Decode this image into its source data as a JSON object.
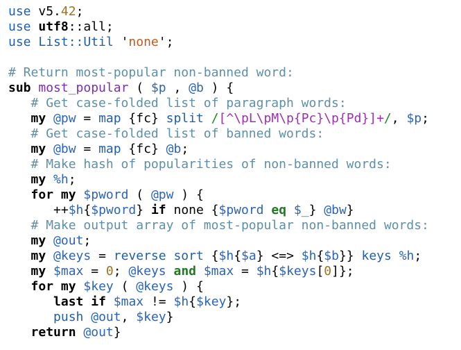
{
  "code": {
    "lines": [
      [
        {
          "t": "use",
          "c": "fn"
        },
        {
          "t": " v5.",
          "c": "pl"
        },
        {
          "t": "42",
          "c": "num"
        },
        {
          "t": ";",
          "c": "pl"
        }
      ],
      [
        {
          "t": "use",
          "c": "fn"
        },
        {
          "t": " ",
          "c": "pl"
        },
        {
          "t": "utf8",
          "c": "kw"
        },
        {
          "t": "::all;",
          "c": "pl"
        }
      ],
      [
        {
          "t": "use",
          "c": "fn"
        },
        {
          "t": " List::Util ",
          "c": "fn"
        },
        {
          "t": "'",
          "c": "pl"
        },
        {
          "t": "none",
          "c": "str"
        },
        {
          "t": "'",
          "c": "pl"
        },
        {
          "t": ";",
          "c": "pl"
        }
      ],
      [],
      [
        {
          "t": "# Return most-popular non-banned word:",
          "c": "cm"
        }
      ],
      [
        {
          "t": "sub",
          "c": "kw"
        },
        {
          "t": " ",
          "c": "pl"
        },
        {
          "t": "most_popular",
          "c": "sub"
        },
        {
          "t": " ( ",
          "c": "pl"
        },
        {
          "t": "$p",
          "c": "v"
        },
        {
          "t": " , ",
          "c": "pl"
        },
        {
          "t": "@b",
          "c": "v"
        },
        {
          "t": " ) {",
          "c": "pl"
        }
      ],
      [
        {
          "t": "   ",
          "c": "pl"
        },
        {
          "t": "# Get case-folded list of paragraph words:",
          "c": "cm"
        }
      ],
      [
        {
          "t": "   ",
          "c": "pl"
        },
        {
          "t": "my",
          "c": "kw"
        },
        {
          "t": " ",
          "c": "pl"
        },
        {
          "t": "@pw",
          "c": "v"
        },
        {
          "t": " = ",
          "c": "pl"
        },
        {
          "t": "map",
          "c": "fn"
        },
        {
          "t": " {fc} ",
          "c": "pl"
        },
        {
          "t": "split",
          "c": "fn"
        },
        {
          "t": " ",
          "c": "pl"
        },
        {
          "t": "/",
          "c": "rxd"
        },
        {
          "t": "[^\\pL\\pM\\p{Pc}\\p{Pd}]+",
          "c": "rx"
        },
        {
          "t": "/",
          "c": "rxd"
        },
        {
          "t": ", ",
          "c": "pl"
        },
        {
          "t": "$p",
          "c": "v"
        },
        {
          "t": ";",
          "c": "pl"
        }
      ],
      [
        {
          "t": "   ",
          "c": "pl"
        },
        {
          "t": "# Get case-folded list of banned words:",
          "c": "cm"
        }
      ],
      [
        {
          "t": "   ",
          "c": "pl"
        },
        {
          "t": "my",
          "c": "kw"
        },
        {
          "t": " ",
          "c": "pl"
        },
        {
          "t": "@bw",
          "c": "v"
        },
        {
          "t": " = ",
          "c": "pl"
        },
        {
          "t": "map",
          "c": "fn"
        },
        {
          "t": " {fc} ",
          "c": "pl"
        },
        {
          "t": "@b",
          "c": "v"
        },
        {
          "t": ";",
          "c": "pl"
        }
      ],
      [
        {
          "t": "   ",
          "c": "pl"
        },
        {
          "t": "# Make hash of popularities of non-banned words:",
          "c": "cm"
        }
      ],
      [
        {
          "t": "   ",
          "c": "pl"
        },
        {
          "t": "my",
          "c": "kw"
        },
        {
          "t": " ",
          "c": "pl"
        },
        {
          "t": "%h",
          "c": "v"
        },
        {
          "t": ";",
          "c": "pl"
        }
      ],
      [
        {
          "t": "   ",
          "c": "pl"
        },
        {
          "t": "for",
          "c": "kw"
        },
        {
          "t": " ",
          "c": "pl"
        },
        {
          "t": "my",
          "c": "kw"
        },
        {
          "t": " ",
          "c": "pl"
        },
        {
          "t": "$pword",
          "c": "v"
        },
        {
          "t": " ( ",
          "c": "pl"
        },
        {
          "t": "@pw",
          "c": "v"
        },
        {
          "t": " ) {",
          "c": "pl"
        }
      ],
      [
        {
          "t": "      ++",
          "c": "pl"
        },
        {
          "t": "$h",
          "c": "v"
        },
        {
          "t": "{",
          "c": "pl"
        },
        {
          "t": "$pword",
          "c": "v"
        },
        {
          "t": "} ",
          "c": "pl"
        },
        {
          "t": "if",
          "c": "kw"
        },
        {
          "t": " none {",
          "c": "pl"
        },
        {
          "t": "$pword",
          "c": "v"
        },
        {
          "t": " ",
          "c": "pl"
        },
        {
          "t": "eq",
          "c": "kw2"
        },
        {
          "t": " ",
          "c": "pl"
        },
        {
          "t": "$_",
          "c": "v"
        },
        {
          "t": "} ",
          "c": "pl"
        },
        {
          "t": "@bw",
          "c": "v"
        },
        {
          "t": "}",
          "c": "pl"
        }
      ],
      [
        {
          "t": "   ",
          "c": "pl"
        },
        {
          "t": "# Make output array of most-popular non-banned words:",
          "c": "cm"
        }
      ],
      [
        {
          "t": "   ",
          "c": "pl"
        },
        {
          "t": "my",
          "c": "kw"
        },
        {
          "t": " ",
          "c": "pl"
        },
        {
          "t": "@out",
          "c": "v"
        },
        {
          "t": ";",
          "c": "pl"
        }
      ],
      [
        {
          "t": "   ",
          "c": "pl"
        },
        {
          "t": "my",
          "c": "kw"
        },
        {
          "t": " ",
          "c": "pl"
        },
        {
          "t": "@keys",
          "c": "v"
        },
        {
          "t": " = ",
          "c": "pl"
        },
        {
          "t": "reverse",
          "c": "fn"
        },
        {
          "t": " ",
          "c": "pl"
        },
        {
          "t": "sort",
          "c": "fn"
        },
        {
          "t": " {",
          "c": "pl"
        },
        {
          "t": "$h",
          "c": "v"
        },
        {
          "t": "{",
          "c": "pl"
        },
        {
          "t": "$a",
          "c": "v"
        },
        {
          "t": "} <=> ",
          "c": "pl"
        },
        {
          "t": "$h",
          "c": "v"
        },
        {
          "t": "{",
          "c": "pl"
        },
        {
          "t": "$b",
          "c": "v"
        },
        {
          "t": "}} ",
          "c": "pl"
        },
        {
          "t": "keys",
          "c": "fn"
        },
        {
          "t": " ",
          "c": "pl"
        },
        {
          "t": "%h",
          "c": "v"
        },
        {
          "t": ";",
          "c": "pl"
        }
      ],
      [
        {
          "t": "   ",
          "c": "pl"
        },
        {
          "t": "my",
          "c": "kw"
        },
        {
          "t": " ",
          "c": "pl"
        },
        {
          "t": "$max",
          "c": "v"
        },
        {
          "t": " = ",
          "c": "pl"
        },
        {
          "t": "0",
          "c": "num"
        },
        {
          "t": "; ",
          "c": "pl"
        },
        {
          "t": "@keys",
          "c": "v"
        },
        {
          "t": " ",
          "c": "pl"
        },
        {
          "t": "and",
          "c": "kw2"
        },
        {
          "t": " ",
          "c": "pl"
        },
        {
          "t": "$max",
          "c": "v"
        },
        {
          "t": " = ",
          "c": "pl"
        },
        {
          "t": "$h",
          "c": "v"
        },
        {
          "t": "{",
          "c": "pl"
        },
        {
          "t": "$keys",
          "c": "v"
        },
        {
          "t": "[",
          "c": "pl"
        },
        {
          "t": "0",
          "c": "num"
        },
        {
          "t": "]};",
          "c": "pl"
        }
      ],
      [
        {
          "t": "   ",
          "c": "pl"
        },
        {
          "t": "for",
          "c": "kw"
        },
        {
          "t": " ",
          "c": "pl"
        },
        {
          "t": "my",
          "c": "kw"
        },
        {
          "t": " ",
          "c": "pl"
        },
        {
          "t": "$key",
          "c": "v"
        },
        {
          "t": " ( ",
          "c": "pl"
        },
        {
          "t": "@keys",
          "c": "v"
        },
        {
          "t": " ) {",
          "c": "pl"
        }
      ],
      [
        {
          "t": "      ",
          "c": "pl"
        },
        {
          "t": "last",
          "c": "kw"
        },
        {
          "t": " ",
          "c": "pl"
        },
        {
          "t": "if",
          "c": "kw"
        },
        {
          "t": " ",
          "c": "pl"
        },
        {
          "t": "$max",
          "c": "v"
        },
        {
          "t": " != ",
          "c": "pl"
        },
        {
          "t": "$h",
          "c": "v"
        },
        {
          "t": "{",
          "c": "pl"
        },
        {
          "t": "$key",
          "c": "v"
        },
        {
          "t": "};",
          "c": "pl"
        }
      ],
      [
        {
          "t": "      ",
          "c": "pl"
        },
        {
          "t": "push",
          "c": "fn"
        },
        {
          "t": " ",
          "c": "pl"
        },
        {
          "t": "@out",
          "c": "v"
        },
        {
          "t": ", ",
          "c": "pl"
        },
        {
          "t": "$key",
          "c": "v"
        },
        {
          "t": "}",
          "c": "pl"
        }
      ],
      [
        {
          "t": "   ",
          "c": "pl"
        },
        {
          "t": "return",
          "c": "kw"
        },
        {
          "t": " ",
          "c": "pl"
        },
        {
          "t": "@out",
          "c": "v"
        },
        {
          "t": "}",
          "c": "pl"
        }
      ]
    ]
  }
}
